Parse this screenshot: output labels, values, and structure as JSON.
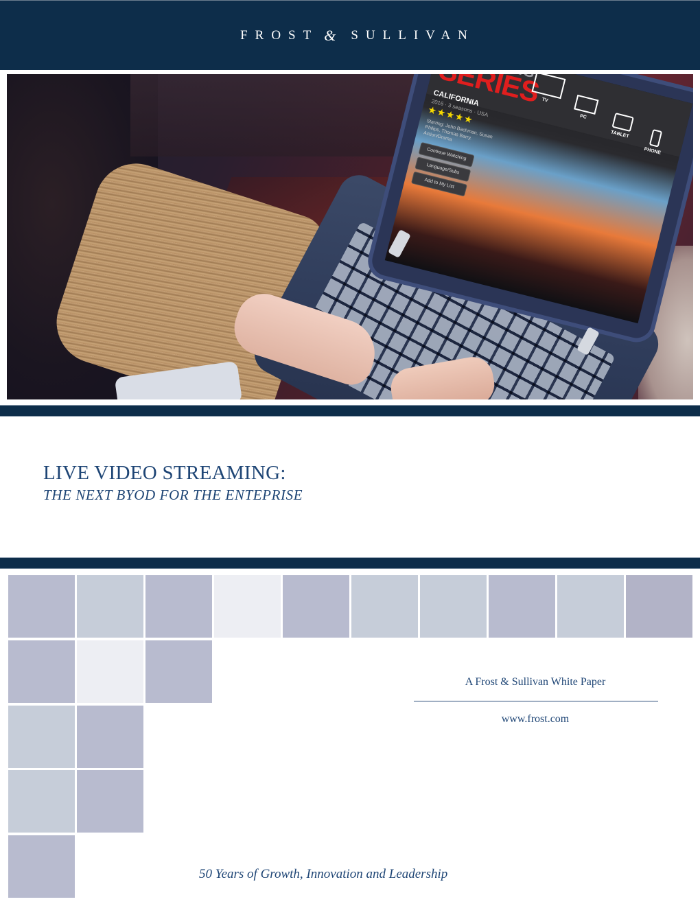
{
  "header": {
    "brand_left": "FROST",
    "brand_amp": "&",
    "brand_right": "SULLIVAN",
    "background": "#0d2d4a"
  },
  "hero": {
    "description": "Person typing on a laptop displaying a streaming video app",
    "screen": {
      "title_line1": "STREAMING",
      "title_line2": "SERIES",
      "show_name": "CALIFORNIA",
      "show_meta": "2016 · 3 seasons · USA",
      "rating_stars": 5,
      "stars_glyph": "★★★★★",
      "cast": "Starring: John Bachman, Susan Philips, Thomas Barry. Action/Drama",
      "buttons": [
        "Continue Watching",
        "Language/Subs",
        "Add to My List"
      ],
      "devices": [
        {
          "label": "TV",
          "icon": "tv-icon"
        },
        {
          "label": "PC",
          "icon": "laptop-icon"
        },
        {
          "label": "TABLET",
          "icon": "tablet-icon"
        },
        {
          "label": "PHONE",
          "icon": "phone-icon"
        }
      ]
    }
  },
  "title": {
    "main": "LIVE VIDEO STREAMING:",
    "subtitle": "THE NEXT BYOD FOR THE ENTEPRISE",
    "color": "#1e4575"
  },
  "tiles": {
    "colors": {
      "dark": "#b8bbcf",
      "mid": "#c6cdd9",
      "light": "#edeef3",
      "darkest": "#b2b3c7"
    },
    "rows": [
      [
        "dark",
        "mid",
        "dark",
        "light",
        "dark",
        "mid",
        "mid",
        "dark",
        "mid",
        "darkest"
      ],
      [
        "dark",
        "light",
        "dark"
      ],
      [
        "mid",
        "dark"
      ],
      [
        "mid",
        "dark"
      ],
      [
        "dark"
      ]
    ]
  },
  "footer": {
    "white_paper_label": "A Frost & Sullivan White Paper",
    "url": "www.frost.com",
    "tagline": "50 Years of Growth, Innovation and Leadership"
  }
}
